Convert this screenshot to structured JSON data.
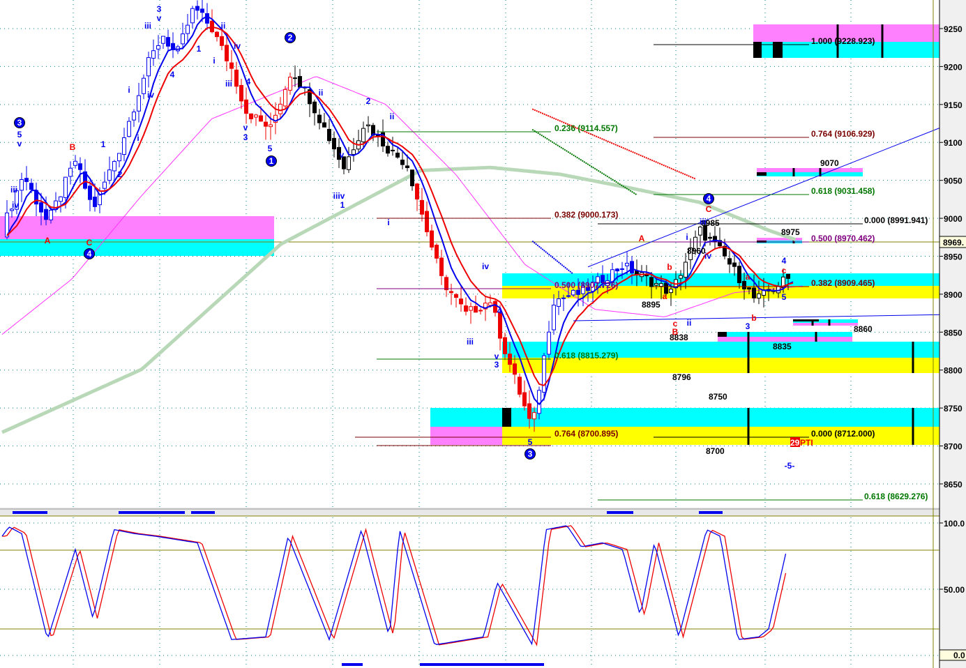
{
  "colors": {
    "blue": "#0000ee",
    "red": "#ee0000",
    "green": "#007700",
    "darkred": "#7a0000",
    "purple": "#800080",
    "black": "#000000",
    "cyan": "#00ffff",
    "yellow": "#ffff00",
    "pink": "#ff80ff",
    "olive": "#808000",
    "long_ma_green": "#b8d8b8",
    "long_ma_magenta": "#ff33ff"
  },
  "chart_data": {
    "type": "candlestick",
    "y_axis": {
      "ticks": [
        "9250",
        "9200",
        "9150",
        "9100",
        "9050",
        "9000",
        "8950",
        "8900",
        "8850",
        "8800",
        "8750",
        "8700",
        "8650"
      ],
      "range": [
        8620,
        9290
      ]
    },
    "current_price_tag": "8969.",
    "price_path": [
      [
        0,
        8984
      ],
      [
        4.3,
        9058
      ],
      [
        9.3,
        8994
      ],
      [
        15,
        9076
      ],
      [
        18.6,
        9012
      ],
      [
        24.3,
        9095
      ],
      [
        30,
        9205
      ],
      [
        32.9,
        9242
      ],
      [
        35.7,
        9214
      ],
      [
        39.3,
        9278
      ],
      [
        42.9,
        9251
      ],
      [
        47.1,
        9196
      ],
      [
        50,
        9141
      ],
      [
        55,
        9118
      ],
      [
        59.3,
        9196
      ],
      [
        62.9,
        9159
      ],
      [
        70,
        9067
      ],
      [
        74.3,
        9127
      ],
      [
        79.3,
        9090
      ],
      [
        82.9,
        9072
      ],
      [
        85.7,
        9012
      ],
      [
        90,
        8920
      ],
      [
        95,
        8874
      ],
      [
        100,
        8892
      ],
      [
        102.9,
        8828
      ],
      [
        108.6,
        8722
      ],
      [
        112.9,
        8892
      ],
      [
        118.6,
        8902
      ],
      [
        127.1,
        8938
      ],
      [
        137.1,
        8902
      ],
      [
        142.9,
        8984
      ],
      [
        147.1,
        8957
      ],
      [
        154.3,
        8892
      ],
      [
        160.7,
        8920
      ]
    ],
    "candle_colors": [
      {
        "from": 0,
        "to": 18,
        "color": "blue"
      },
      {
        "from": 18,
        "to": 43,
        "color": "blue"
      },
      {
        "from": 43,
        "to": 60,
        "color": "red"
      },
      {
        "from": 60,
        "to": 85,
        "color": "black"
      },
      {
        "from": 85,
        "to": 110,
        "color": "red"
      },
      {
        "from": 110,
        "to": 130,
        "color": "blue"
      },
      {
        "from": 130,
        "to": 162,
        "color": "black"
      }
    ],
    "ma_fast_period": 4,
    "ma_slow_period": 8,
    "long_ma_green": [
      [
        0,
        8718
      ],
      [
        28.6,
        8801
      ],
      [
        57.1,
        8966
      ],
      [
        85.7,
        9063
      ],
      [
        100,
        9067
      ],
      [
        114.3,
        9058
      ],
      [
        128.6,
        9040
      ],
      [
        142.9,
        9021
      ],
      [
        157.1,
        8984
      ],
      [
        162.9,
        8971
      ]
    ],
    "long_ma_magenta": [
      [
        0,
        8847
      ],
      [
        14.3,
        8920
      ],
      [
        28.6,
        9030
      ],
      [
        42.9,
        9131
      ],
      [
        64.3,
        9187
      ],
      [
        78.6,
        9150
      ],
      [
        92.9,
        9058
      ],
      [
        107.1,
        8939
      ],
      [
        121.4,
        8880
      ],
      [
        135.7,
        8870
      ],
      [
        150,
        8902
      ],
      [
        164.3,
        8911
      ]
    ],
    "trendlines": [
      {
        "color": "blue",
        "from": [
          120,
          8936
        ],
        "to": [
          192.4,
          9120
        ],
        "style": "solid"
      },
      {
        "color": "blue",
        "from": [
          117,
          8865
        ],
        "to": [
          192.4,
          8873
        ],
        "style": "solid"
      },
      {
        "color": "red",
        "from": [
          108.6,
          9144
        ],
        "to": [
          142,
          9052
        ],
        "style": "x"
      },
      {
        "color": "green",
        "from": [
          108.6,
          9117
        ],
        "to": [
          130,
          9031
        ],
        "style": "x"
      },
      {
        "color": "blue",
        "from": [
          108.6,
          8970
        ],
        "to": [
          116.9,
          8927
        ],
        "style": "x"
      }
    ],
    "oscillator": {
      "type": "line",
      "ticks": [
        "100.0",
        "50.00"
      ],
      "current_tag": "0.0",
      "levels": [
        80,
        20
      ],
      "range": [
        0,
        100
      ],
      "k": [
        [
          0,
          90
        ],
        [
          1.4,
          97
        ],
        [
          4,
          92
        ],
        [
          9.3,
          12
        ],
        [
          15,
          80
        ],
        [
          18.6,
          28
        ],
        [
          22.9,
          95
        ],
        [
          27,
          92
        ],
        [
          31.4,
          90
        ],
        [
          40,
          85
        ],
        [
          47,
          12
        ],
        [
          54,
          14
        ],
        [
          58.6,
          90
        ],
        [
          67,
          12
        ],
        [
          73.6,
          95
        ],
        [
          79.3,
          14
        ],
        [
          81.4,
          95
        ],
        [
          88.6,
          8
        ],
        [
          98.6,
          14
        ],
        [
          101.4,
          55
        ],
        [
          108.6,
          8
        ],
        [
          111.4,
          95
        ],
        [
          115.7,
          98
        ],
        [
          118.6,
          82
        ],
        [
          122.9,
          85
        ],
        [
          127.1,
          80
        ],
        [
          130.7,
          30
        ],
        [
          133.6,
          85
        ],
        [
          138.6,
          14
        ],
        [
          144.3,
          95
        ],
        [
          147.1,
          90
        ],
        [
          150.7,
          12
        ],
        [
          155,
          14
        ],
        [
          157,
          20
        ],
        [
          160.7,
          80
        ]
      ]
    }
  },
  "fib_labels": [
    {
      "text": "0.236 (9114.557)",
      "color": "green"
    },
    {
      "text": "0.382 (9000.173)",
      "color": "darkred"
    },
    {
      "text": "0.500 (8907.726)",
      "color": "purple"
    },
    {
      "text": "0.618 (8815.279)",
      "color": "green"
    },
    {
      "text": "0.764 (8700.895)",
      "color": "darkred"
    },
    {
      "text": "1.000 (9228.923)",
      "color": "black"
    },
    {
      "text": "0.764 (9106.929)",
      "color": "darkred"
    },
    {
      "text": "0.618 (9031.458)",
      "color": "green"
    },
    {
      "text": "0.500 (8970.462)",
      "color": "purple"
    },
    {
      "text": "0.382 (8909.465)",
      "color": "darkred"
    },
    {
      "text": "0.000 (8712.000)",
      "color": "black"
    },
    {
      "text": "0.000 (8991.941)",
      "color": "black"
    },
    {
      "text": "0.618 (8629.276)",
      "color": "green"
    }
  ],
  "price_labels": [
    "8975",
    "9070",
    "8860",
    "8835",
    "8838",
    "8796",
    "8750",
    "8700",
    "8895",
    "8960",
    "8985"
  ],
  "pti_label": {
    "count": "29",
    "text": "PTI"
  },
  "circled_waves": [
    "3",
    "4",
    "2",
    "1",
    "3",
    "4"
  ],
  "wave_labels": [
    {
      "t": "5",
      "c": "blue"
    },
    {
      "t": "v",
      "c": "blue"
    },
    {
      "t": "iii",
      "c": "blue"
    },
    {
      "t": "iv",
      "c": "blue"
    },
    {
      "t": "3",
      "c": "blue"
    },
    {
      "t": "v",
      "c": "blue"
    },
    {
      "t": "iii",
      "c": "blue"
    },
    {
      "t": "iv",
      "c": "blue"
    },
    {
      "t": "i",
      "c": "blue"
    },
    {
      "t": "i",
      "c": "blue"
    },
    {
      "t": "1",
      "c": "blue"
    },
    {
      "t": "2",
      "c": "blue"
    },
    {
      "t": "4",
      "c": "blue"
    },
    {
      "t": "1",
      "c": "blue"
    },
    {
      "t": "ii",
      "c": "blue"
    },
    {
      "t": "iv",
      "c": "blue"
    },
    {
      "t": "i",
      "c": "blue"
    },
    {
      "t": "iii",
      "c": "blue"
    },
    {
      "t": "4",
      "c": "blue"
    },
    {
      "t": "v",
      "c": "blue"
    },
    {
      "t": "3",
      "c": "blue"
    },
    {
      "t": "5",
      "c": "blue"
    },
    {
      "t": "ii",
      "c": "blue"
    },
    {
      "t": "2",
      "c": "blue"
    },
    {
      "t": "ii",
      "c": "blue"
    },
    {
      "t": "v",
      "c": "blue"
    },
    {
      "t": "iiiv",
      "c": "blue"
    },
    {
      "t": "1",
      "c": "blue"
    },
    {
      "t": "i",
      "c": "blue"
    },
    {
      "t": "iv",
      "c": "blue"
    },
    {
      "t": "4",
      "c": "blue"
    },
    {
      "t": "iii",
      "c": "blue"
    },
    {
      "t": "v",
      "c": "blue"
    },
    {
      "t": "3",
      "c": "blue"
    },
    {
      "t": "5",
      "c": "blue"
    },
    {
      "t": "i",
      "c": "blue"
    },
    {
      "t": "iii",
      "c": "blue"
    },
    {
      "t": "iv",
      "c": "blue"
    },
    {
      "t": "ii",
      "c": "blue"
    },
    {
      "t": "3",
      "c": "blue"
    },
    {
      "t": "4",
      "c": "blue"
    },
    {
      "t": "5",
      "c": "blue"
    },
    {
      "t": "-5-",
      "c": "blue"
    },
    {
      "t": "B",
      "c": "red"
    },
    {
      "t": "A",
      "c": "red"
    },
    {
      "t": "C",
      "c": "red"
    },
    {
      "t": "A",
      "c": "red"
    },
    {
      "t": "C",
      "c": "red"
    },
    {
      "t": "b",
      "c": "red"
    },
    {
      "t": "a",
      "c": "red"
    },
    {
      "t": "c",
      "c": "red"
    },
    {
      "t": "B",
      "c": "red"
    },
    {
      "t": "a",
      "c": "red"
    },
    {
      "t": "b",
      "c": "red"
    },
    {
      "t": "c",
      "c": "red"
    }
  ]
}
